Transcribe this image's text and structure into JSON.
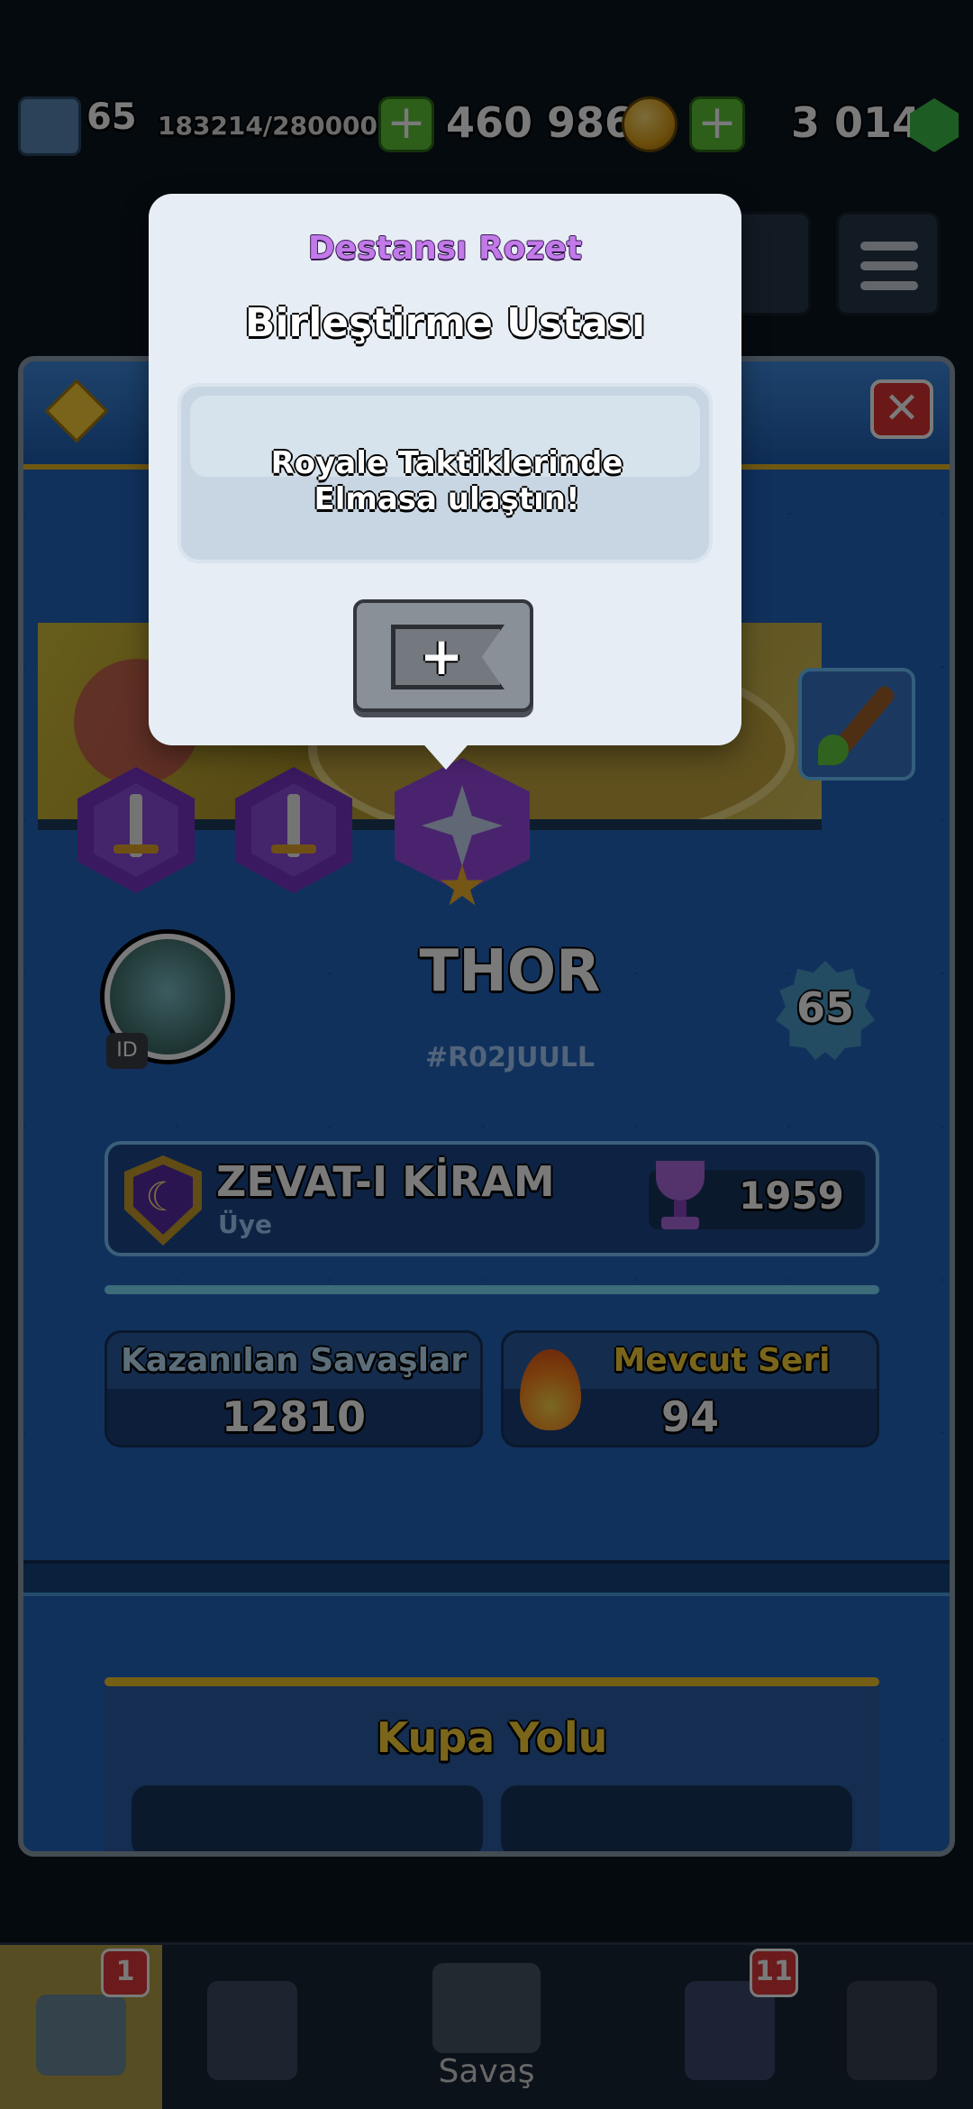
{
  "topbar": {
    "level": "65",
    "xp": "183214/280000",
    "gold": "460 986",
    "gems": "3 014"
  },
  "profile": {
    "player_name": "THOR",
    "player_tag": "#R02JUULL",
    "id_label": "ID",
    "level": "65",
    "clan": {
      "name": "ZEVAT-I KİRAM",
      "role": "Üye",
      "trophies": "1959"
    },
    "stats": {
      "wins_label": "Kazanılan Savaşlar",
      "wins_value": "12810",
      "streak_label": "Mevcut Seri",
      "streak_value": "94"
    },
    "section_title": "Kupa Yolu"
  },
  "popup": {
    "subtitle": "Destansı Rozet",
    "title": "Birleştirme Ustası",
    "description": "Royale Taktiklerinde Elmasa ulaştın!",
    "button_symbol": "+"
  },
  "bottom_nav": {
    "battle_label": "Savaş",
    "shop_badge": "1",
    "clan_badge": "11"
  },
  "colors": {
    "panel_blue": "#2466c3",
    "gold_accent": "#f5c62a",
    "epic_purple": "#c27ae8",
    "close_red": "#e03434"
  }
}
